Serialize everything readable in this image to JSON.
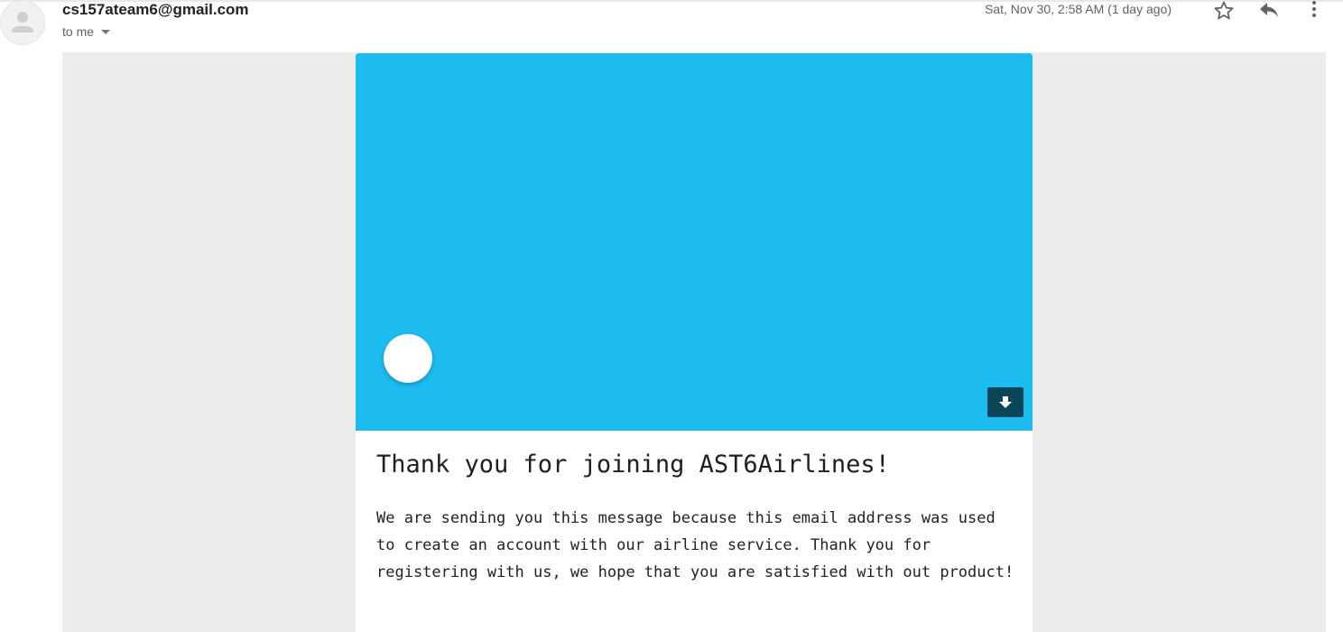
{
  "message": {
    "sender": "cs157ateam6@gmail.com",
    "recipient_label": "to me",
    "date": "Sat, Nov 30, 2:58 AM (1 day ago)"
  },
  "icons": {
    "avatar": "person-avatar-icon",
    "star": "star-icon",
    "reply": "reply-icon",
    "more": "more-vertical-icon",
    "download": "download-arrow-icon"
  },
  "email_body": {
    "hero_color": "#1cbbf0",
    "heading": "Thank you for joining AST6Airlines!",
    "paragraph": "We are sending you this message because this email address was used to create an account with our airline service. Thank you for registering with us, we hope that you are satisfied with out product!"
  }
}
